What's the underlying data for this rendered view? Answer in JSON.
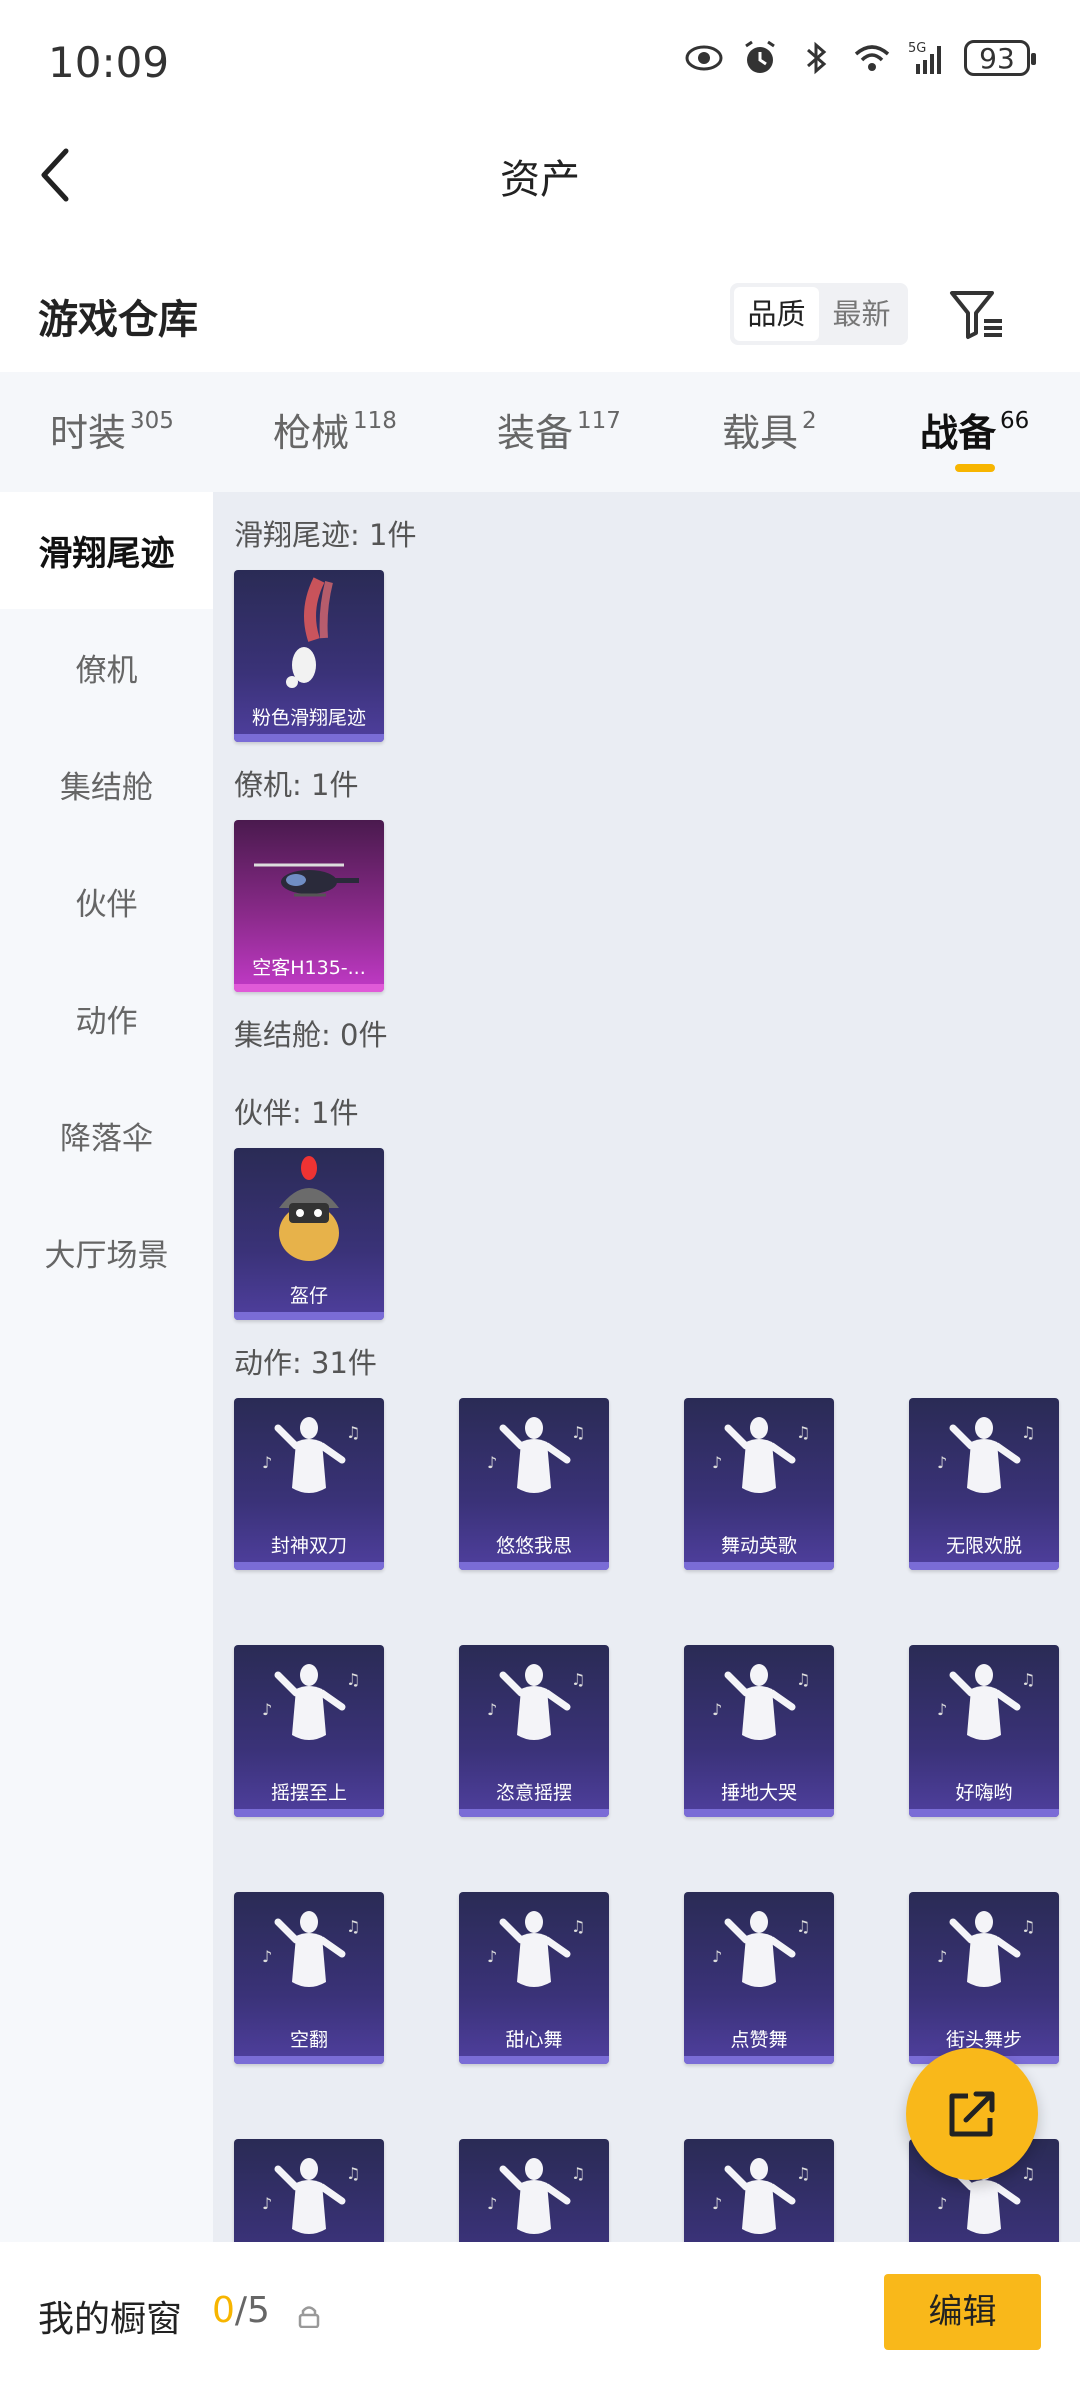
{
  "status": {
    "time": "10:09",
    "battery": "93"
  },
  "nav": {
    "title": "资产"
  },
  "header": {
    "title": "游戏仓库",
    "sort_quality": "品质",
    "sort_latest": "最新"
  },
  "tabs": [
    {
      "label": "时装",
      "count": "305"
    },
    {
      "label": "枪械",
      "count": "118"
    },
    {
      "label": "装备",
      "count": "117"
    },
    {
      "label": "载具",
      "count": "2"
    },
    {
      "label": "战备",
      "count": "66"
    }
  ],
  "side_menu": [
    "滑翔尾迹",
    "僚机",
    "集结舱",
    "伙伴",
    "动作",
    "降落伞",
    "大厅场景"
  ],
  "sections": {
    "glide": {
      "title": "滑翔尾迹: 1件",
      "items": [
        "粉色滑翔尾迹"
      ]
    },
    "wingman": {
      "title": "僚机: 1件",
      "items": [
        "空客H135-..."
      ]
    },
    "pod": {
      "title": "集结舱: 0件"
    },
    "partner": {
      "title": "伙伴: 1件",
      "items": [
        "盔仔"
      ]
    },
    "actions": {
      "title": "动作: 31件",
      "items": [
        "封神双刀",
        "悠悠我思",
        "舞动英歌",
        "无限欢脱",
        "摇摆至上",
        "恣意摇摆",
        "捶地大哭",
        "好嗨哟",
        "空翻",
        "甜心舞",
        "点赞舞",
        "街头舞步",
        "",
        "",
        "",
        ""
      ]
    }
  },
  "bottom": {
    "window_label": "我的橱窗",
    "count_current": "0",
    "count_total": "/5",
    "edit_label": "编辑"
  },
  "colors": {
    "accent": "#f9b81a",
    "card_bg": "#3a3278",
    "content_bg": "#eaedf3"
  }
}
